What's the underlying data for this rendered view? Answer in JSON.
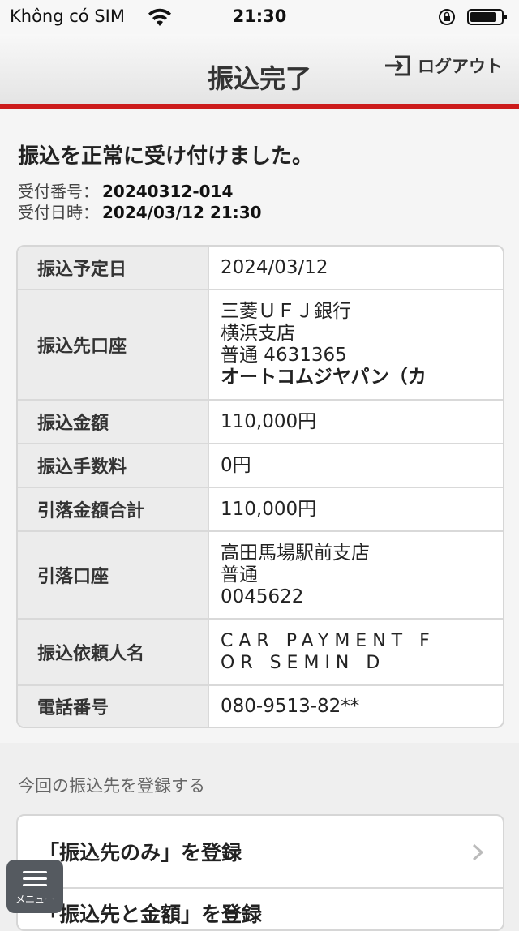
{
  "status_bar": {
    "carrier": "Không có SIM",
    "time": "21:30"
  },
  "nav": {
    "title": "振込完了",
    "logout_label": "ログアウト"
  },
  "receipt": {
    "message": "振込を正常に受け付けました。",
    "receipt_no_label": "受付番号：",
    "receipt_no": "20240312-014",
    "receipt_datetime_label": "受付日時：",
    "receipt_datetime": "2024/03/12 21:30"
  },
  "details": {
    "scheduled_date_label": "振込予定日",
    "scheduled_date": "2024/03/12",
    "dest_account_label": "振込先口座",
    "dest_bank": "三菱ＵＦＪ銀行",
    "dest_branch": "横浜支店",
    "dest_account": "普通 4631365",
    "dest_name": "オートコムジヤパン（カ",
    "amount_label": "振込金額",
    "amount": "110,000円",
    "fee_label": "振込手数料",
    "fee": "0円",
    "total_label": "引落金額合計",
    "total": "110,000円",
    "debit_account_label": "引落口座",
    "debit_branch": "高田馬場駅前支店",
    "debit_type": "普通",
    "debit_number": "0045622",
    "requester_label": "振込依頼人名",
    "requester_line1": "CAR PAYMENT F",
    "requester_line2": "OR SEMIN D",
    "phone_label": "電話番号",
    "phone": "080-9513-82**"
  },
  "register": {
    "section_label": "今回の振込先を登録する",
    "option1": "「振込先のみ」を登録",
    "option2": "「振込先と金額」を登録"
  },
  "menu": {
    "label": "メニュー"
  },
  "colors": {
    "accent_red": "#cc1b1b"
  }
}
